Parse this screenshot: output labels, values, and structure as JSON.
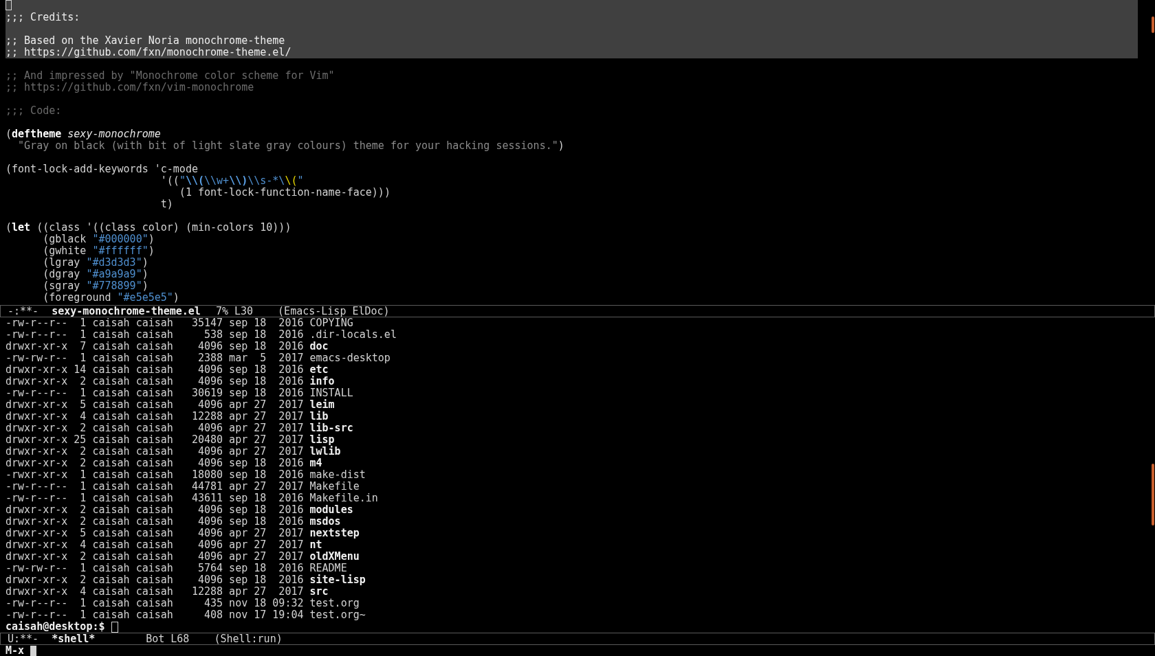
{
  "editor": {
    "lines": [
      {
        "kind": "cursor",
        "highlighted": true
      },
      {
        "kind": "text",
        "highlighted": true,
        "segments": [
          {
            "kind": "comment",
            "text": ";;; Credits:"
          }
        ]
      },
      {
        "kind": "blank",
        "highlighted": true
      },
      {
        "kind": "text",
        "highlighted": true,
        "segments": [
          {
            "kind": "comment",
            "text": ";; Based on the Xavier Noria monochrome-theme"
          }
        ]
      },
      {
        "kind": "text",
        "highlighted": true,
        "segments": [
          {
            "kind": "comment",
            "text": ";; https://github.com/fxn/monochrome-theme.el/"
          }
        ]
      },
      {
        "kind": "blank",
        "highlighted": false
      },
      {
        "kind": "text",
        "highlighted": false,
        "segments": [
          {
            "kind": "comment",
            "text": ";; And impressed by \"Monochrome color scheme for Vim\""
          }
        ]
      },
      {
        "kind": "text",
        "highlighted": false,
        "segments": [
          {
            "kind": "comment",
            "text": ";; https://github.com/fxn/vim-monochrome"
          }
        ]
      },
      {
        "kind": "blank",
        "highlighted": false
      },
      {
        "kind": "text",
        "highlighted": false,
        "segments": [
          {
            "kind": "comment",
            "text": ";;; Code:"
          }
        ]
      },
      {
        "kind": "blank",
        "highlighted": false
      },
      {
        "kind": "text",
        "highlighted": false,
        "segments": [
          {
            "kind": "plain",
            "text": "("
          },
          {
            "kind": "keyword",
            "text": "deftheme"
          },
          {
            "kind": "name",
            "text": " sexy-monochrome"
          }
        ]
      },
      {
        "kind": "text",
        "highlighted": false,
        "segments": [
          {
            "kind": "doc",
            "text": "  \"Gray on black (with bit of light slate gray colours) theme for your hacking sessions.\""
          },
          {
            "kind": "plain",
            "text": ")"
          }
        ]
      },
      {
        "kind": "blank",
        "highlighted": false
      },
      {
        "kind": "text",
        "highlighted": false,
        "segments": [
          {
            "kind": "plain",
            "text": "(font-lock-add-keywords 'c-mode"
          }
        ]
      },
      {
        "kind": "text",
        "highlighted": false,
        "segments": [
          {
            "kind": "plain",
            "text": "                         '(("
          },
          {
            "kind": "string",
            "text": "\""
          },
          {
            "kind": "escape",
            "text": "\\\\("
          },
          {
            "kind": "string",
            "text": "\\\\w+"
          },
          {
            "kind": "escape",
            "text": "\\\\)"
          },
          {
            "kind": "string",
            "text": "\\\\s-*\\"
          },
          {
            "kind": "paren",
            "text": "\\("
          },
          {
            "kind": "string",
            "text": "\""
          }
        ]
      },
      {
        "kind": "text",
        "highlighted": false,
        "segments": [
          {
            "kind": "plain",
            "text": "                            (1 font-lock-function-name-face)))"
          }
        ]
      },
      {
        "kind": "text",
        "highlighted": false,
        "segments": [
          {
            "kind": "plain",
            "text": "                         t)"
          }
        ]
      },
      {
        "kind": "blank",
        "highlighted": false
      },
      {
        "kind": "text",
        "highlighted": false,
        "segments": [
          {
            "kind": "plain",
            "text": "("
          },
          {
            "kind": "keyword",
            "text": "let"
          },
          {
            "kind": "plain",
            "text": " ((class '((class color) (min-colors 10)))"
          }
        ]
      },
      {
        "kind": "text",
        "highlighted": false,
        "segments": [
          {
            "kind": "plain",
            "text": "      (gblack "
          },
          {
            "kind": "string",
            "text": "\"#000000\""
          },
          {
            "kind": "plain",
            "text": ")"
          }
        ]
      },
      {
        "kind": "text",
        "highlighted": false,
        "segments": [
          {
            "kind": "plain",
            "text": "      (gwhite "
          },
          {
            "kind": "string",
            "text": "\"#ffffff\""
          },
          {
            "kind": "plain",
            "text": ")"
          }
        ]
      },
      {
        "kind": "text",
        "highlighted": false,
        "segments": [
          {
            "kind": "plain",
            "text": "      (lgray "
          },
          {
            "kind": "string",
            "text": "\"#d3d3d3\""
          },
          {
            "kind": "plain",
            "text": ")"
          }
        ]
      },
      {
        "kind": "text",
        "highlighted": false,
        "segments": [
          {
            "kind": "plain",
            "text": "      (dgray "
          },
          {
            "kind": "string",
            "text": "\"#a9a9a9\""
          },
          {
            "kind": "plain",
            "text": ")"
          }
        ]
      },
      {
        "kind": "text",
        "highlighted": false,
        "segments": [
          {
            "kind": "plain",
            "text": "      (sgray "
          },
          {
            "kind": "string",
            "text": "\"#778899\""
          },
          {
            "kind": "plain",
            "text": ")"
          }
        ]
      },
      {
        "kind": "text",
        "highlighted": false,
        "segments": [
          {
            "kind": "plain",
            "text": "      (foreground "
          },
          {
            "kind": "string",
            "text": "\"#e5e5e5\""
          },
          {
            "kind": "plain",
            "text": ")"
          }
        ]
      }
    ]
  },
  "editor_mode_line": {
    "state": "-:**-",
    "buffer": "sexy-monochrome-theme.el",
    "position": "7% L30",
    "modes": "(Emacs-Lisp ElDoc)"
  },
  "shell": {
    "rows": [
      {
        "info": "-rw-r--r--  1 caisah caisah   35147 sep 18  2016",
        "name": "COPYING",
        "directory": false
      },
      {
        "info": "-rw-r--r--  1 caisah caisah     538 sep 18  2016",
        "name": ".dir-locals.el",
        "directory": false
      },
      {
        "info": "drwxr-xr-x  7 caisah caisah    4096 sep 18  2016",
        "name": "doc",
        "directory": true
      },
      {
        "info": "-rw-rw-r--  1 caisah caisah    2388 mar  5  2017",
        "name": "emacs-desktop",
        "directory": false
      },
      {
        "info": "drwxr-xr-x 14 caisah caisah    4096 sep 18  2016",
        "name": "etc",
        "directory": true
      },
      {
        "info": "drwxr-xr-x  2 caisah caisah    4096 sep 18  2016",
        "name": "info",
        "directory": true
      },
      {
        "info": "-rw-r--r--  1 caisah caisah   30619 sep 18  2016",
        "name": "INSTALL",
        "directory": false
      },
      {
        "info": "drwxr-xr-x  5 caisah caisah    4096 apr 27  2017",
        "name": "leim",
        "directory": true
      },
      {
        "info": "drwxr-xr-x  4 caisah caisah   12288 apr 27  2017",
        "name": "lib",
        "directory": true
      },
      {
        "info": "drwxr-xr-x  2 caisah caisah    4096 apr 27  2017",
        "name": "lib-src",
        "directory": true
      },
      {
        "info": "drwxr-xr-x 25 caisah caisah   20480 apr 27  2017",
        "name": "lisp",
        "directory": true
      },
      {
        "info": "drwxr-xr-x  2 caisah caisah    4096 apr 27  2017",
        "name": "lwlib",
        "directory": true
      },
      {
        "info": "drwxr-xr-x  2 caisah caisah    4096 sep 18  2016",
        "name": "m4",
        "directory": true
      },
      {
        "info": "-rwxr-xr-x  1 caisah caisah   18080 sep 18  2016",
        "name": "make-dist",
        "directory": false
      },
      {
        "info": "-rw-r--r--  1 caisah caisah   44781 apr 27  2017",
        "name": "Makefile",
        "directory": false
      },
      {
        "info": "-rw-r--r--  1 caisah caisah   43611 sep 18  2016",
        "name": "Makefile.in",
        "directory": false
      },
      {
        "info": "drwxr-xr-x  2 caisah caisah    4096 sep 18  2016",
        "name": "modules",
        "directory": true
      },
      {
        "info": "drwxr-xr-x  2 caisah caisah    4096 sep 18  2016",
        "name": "msdos",
        "directory": true
      },
      {
        "info": "drwxr-xr-x  5 caisah caisah    4096 apr 27  2017",
        "name": "nextstep",
        "directory": true
      },
      {
        "info": "drwxr-xr-x  4 caisah caisah    4096 apr 27  2017",
        "name": "nt",
        "directory": true
      },
      {
        "info": "drwxr-xr-x  2 caisah caisah    4096 apr 27  2017",
        "name": "oldXMenu",
        "directory": true
      },
      {
        "info": "-rw-rw-r--  1 caisah caisah    5764 sep 18  2016",
        "name": "README",
        "directory": false
      },
      {
        "info": "drwxr-xr-x  2 caisah caisah    4096 sep 18  2016",
        "name": "site-lisp",
        "directory": true
      },
      {
        "info": "drwxr-xr-x  4 caisah caisah   12288 apr 27  2017",
        "name": "src",
        "directory": true
      },
      {
        "info": "-rw-r--r--  1 caisah caisah     435 nov 18 09:32",
        "name": "test.org",
        "directory": false
      },
      {
        "info": "-rw-r--r--  1 caisah caisah     408 nov 17 19:04",
        "name": "test.org~",
        "directory": false
      }
    ],
    "prompt": "caisah@desktop:$"
  },
  "shell_mode_line": {
    "state": "U:**-",
    "buffer": "*shell*",
    "position": "Bot L68",
    "modes": "(Shell:run)"
  },
  "minibuffer": {
    "text": "M-x"
  }
}
